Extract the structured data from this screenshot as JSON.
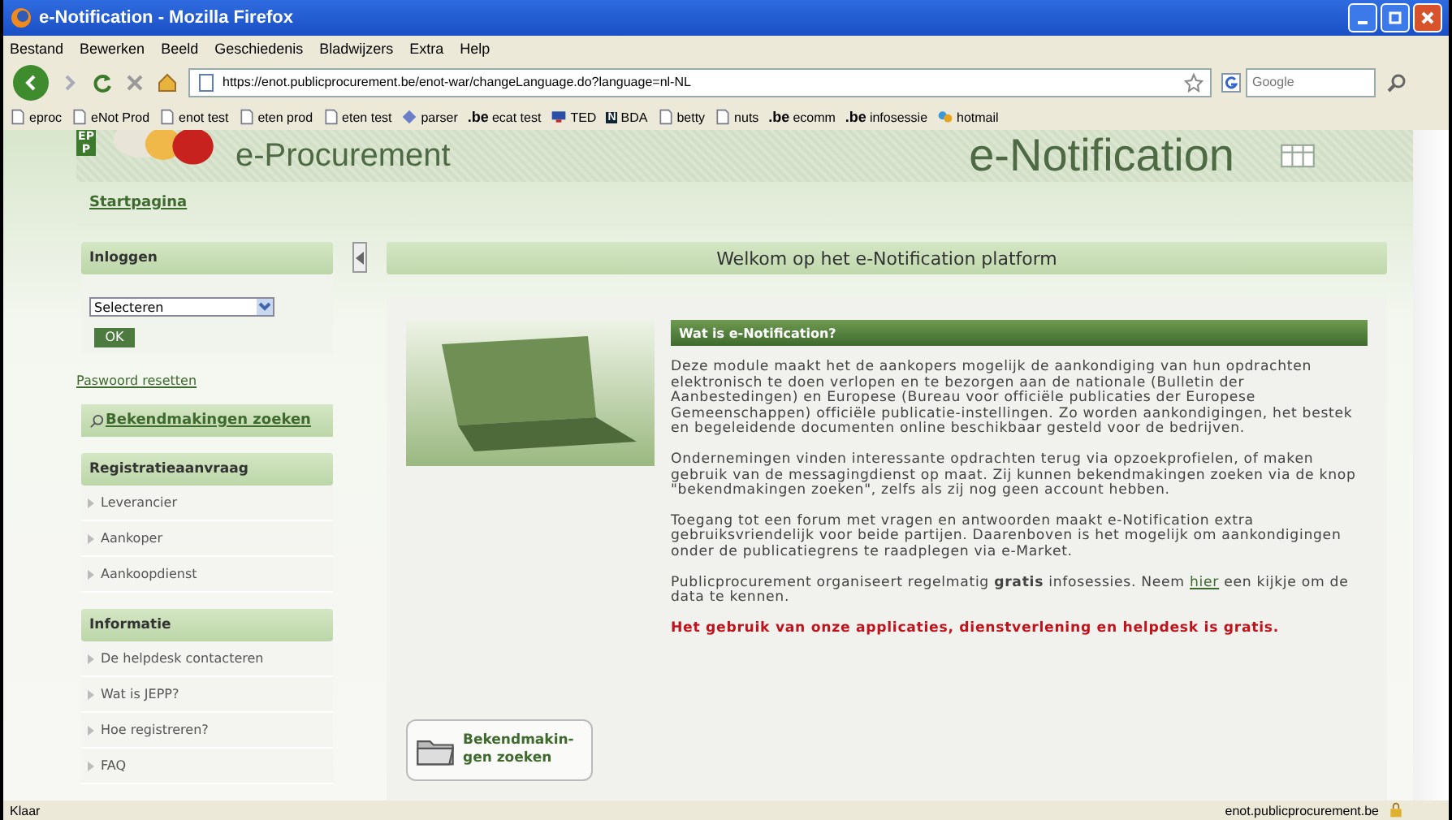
{
  "window": {
    "title": "e-Notification - Mozilla Firefox"
  },
  "menu": [
    "Bestand",
    "Bewerken",
    "Beeld",
    "Geschiedenis",
    "Bladwijzers",
    "Extra",
    "Help"
  ],
  "address": {
    "value": "https://enot.publicprocurement.be/enot-war/changeLanguage.do?language=nl-NL"
  },
  "search": {
    "placeholder": "Google"
  },
  "bookmarks": [
    {
      "label": "eproc",
      "kind": "page"
    },
    {
      "label": "eNot Prod",
      "kind": "page"
    },
    {
      "label": "enot test",
      "kind": "page"
    },
    {
      "label": "eten prod",
      "kind": "page"
    },
    {
      "label": "eten test",
      "kind": "page"
    },
    {
      "label": "parser",
      "kind": "diamond"
    },
    {
      "label": "ecat test",
      "kind": "be",
      "badge": ".be"
    },
    {
      "label": "TED",
      "kind": "monitor"
    },
    {
      "label": "BDA",
      "kind": "n",
      "badge": "N"
    },
    {
      "label": "betty",
      "kind": "page"
    },
    {
      "label": "nuts",
      "kind": "page"
    },
    {
      "label": "ecomm",
      "kind": "be",
      "badge": ".be"
    },
    {
      "label": "infosessie",
      "kind": "be",
      "badge": ".be"
    },
    {
      "label": "hotmail",
      "kind": "msn"
    }
  ],
  "header": {
    "logo_letters": "EPP",
    "left_title": "e-Procurement",
    "right_title": "e-Notification"
  },
  "breadcrumb": "Startpagina",
  "sidebar": {
    "login": {
      "title": "Inloggen",
      "select": "Selecteren",
      "ok": "OK",
      "reset": "Paswoord resetten"
    },
    "search_box": "Bekendmakingen zoeken",
    "sections": [
      {
        "title": "Registratieaanvraag",
        "items": [
          "Leverancier",
          "Aankoper",
          "Aankoopdienst"
        ]
      },
      {
        "title": "Informatie",
        "items": [
          "De helpdesk contacteren",
          "Wat is JEPP?",
          "Hoe registreren?",
          "FAQ"
        ]
      }
    ]
  },
  "welcome": "Welkom op het e-Notification platform",
  "article": {
    "title": "Wat is e-Notification?",
    "paragraphs": [
      {
        "kind": "plain",
        "parts": [
          {
            "kind": "text",
            "text": "Deze module maakt het de aankopers mogelijk de aankondiging van hun opdrachten elektronisch te doen verlopen en te bezorgen aan de nationale (Bulletin der Aanbestedingen) en Europese (Bureau voor officiële publicaties der Europese Gemeenschappen) officiële publicatie-instellingen. Zo worden aankondigingen, het bestek en begeleidende documenten online beschikbaar gesteld voor de bedrijven."
          }
        ]
      },
      {
        "kind": "plain",
        "parts": [
          {
            "kind": "text",
            "text": "Ondernemingen vinden interessante opdrachten terug via opzoekprofielen, of maken gebruik van de messagingdienst op maat. Zij kunnen bekendmakingen zoeken via de knop \"bekendmakingen zoeken\", zelfs als zij nog geen account hebben."
          }
        ]
      },
      {
        "kind": "plain",
        "parts": [
          {
            "kind": "text",
            "text": "Toegang tot een forum met vragen en antwoorden maakt e-Notification extra gebruiksvriendelijk voor beide partijen. Daarenboven is het mogelijk om aankondigingen onder de publicatiegrens te raadplegen via e-Market."
          }
        ]
      },
      {
        "kind": "plain",
        "parts": [
          {
            "kind": "text",
            "text": "Publicprocurement organiseert regelmatig **gratis** infosessies. Neem "
          },
          {
            "kind": "link",
            "text": "hier"
          },
          {
            "kind": "text",
            "text": " een kijkje om de data te kennen."
          }
        ]
      },
      {
        "kind": "alert",
        "parts": [
          {
            "kind": "text",
            "text": "Het gebruik van onze applicaties, dienstverlening en helpdesk is gratis."
          }
        ]
      }
    ]
  },
  "search_button": "Bekendmakin-gen zoeken",
  "status_bar": {
    "text": "Klaar",
    "host": "enot.publicprocurement.be"
  }
}
